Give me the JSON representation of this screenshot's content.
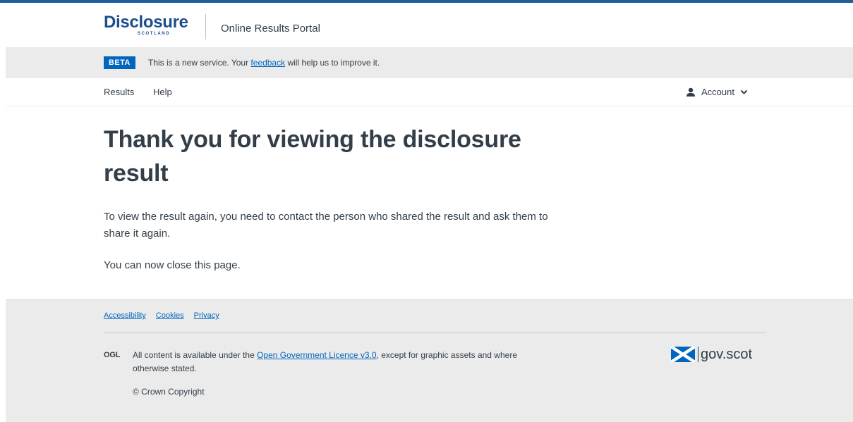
{
  "header": {
    "logo_word": "Disclosure",
    "logo_sub": "SCOTLAND",
    "portal_name": "Online Results Portal"
  },
  "beta": {
    "tag": "BETA",
    "text_before": "This is a new service. Your ",
    "link": "feedback",
    "text_after": " will help us to improve it."
  },
  "nav": {
    "items": [
      {
        "label": "Results"
      },
      {
        "label": "Help"
      }
    ],
    "account_label": "Account"
  },
  "main": {
    "title": "Thank you for viewing the disclosure result",
    "paragraph1": "To view the result again, you need to contact the person who shared the result and ask them to share it again.",
    "paragraph2": "You can now close this page."
  },
  "footer": {
    "links": [
      {
        "label": "Accessibility"
      },
      {
        "label": "Cookies"
      },
      {
        "label": "Privacy"
      }
    ],
    "ogl": "OGL",
    "licence_before": "All content is available under the ",
    "licence_link": "Open Government Licence v3.0",
    "licence_after": ", except for graphic assets and where otherwise stated.",
    "copyright": "© Crown Copyright",
    "govscot": "gov.scot"
  },
  "colors": {
    "brand_blue": "#0065bd",
    "logo_blue": "#1d4d8c",
    "text": "#333e48",
    "grey_bg": "#ebebeb"
  },
  "icons": {
    "account": "person-icon",
    "chevron": "chevron-down-icon",
    "saltire": "saltire-flag-icon"
  }
}
